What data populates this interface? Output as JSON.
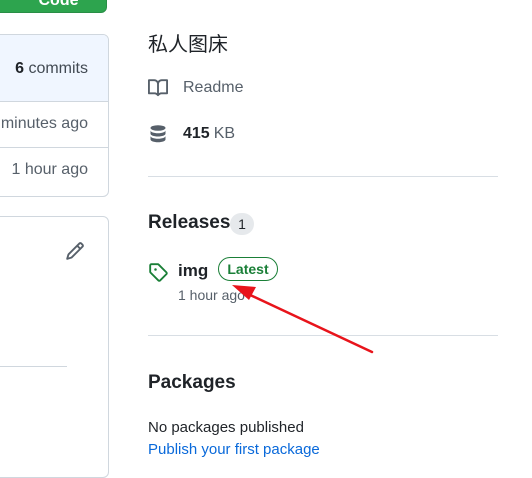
{
  "left": {
    "code_button_label": "Code",
    "commits_count": "6",
    "commits_label": "commits",
    "commit_times": [
      "minutes ago",
      "1 hour ago"
    ]
  },
  "about": {
    "description": "私人图床",
    "readme_label": "Readme",
    "size_value": "415",
    "size_unit": "KB"
  },
  "releases": {
    "title": "Releases",
    "count": "1",
    "items": [
      {
        "name": "img",
        "badge": "Latest",
        "time": "1 hour ago"
      }
    ]
  },
  "packages": {
    "title": "Packages",
    "empty_text": "No packages published",
    "publish_link": "Publish your first package"
  },
  "colors": {
    "accent_green": "#2da44e",
    "link_blue": "#0969da",
    "annotation_red": "#e8141b"
  },
  "icons": [
    "book-icon",
    "database-icon",
    "tag-icon",
    "pencil-icon"
  ]
}
